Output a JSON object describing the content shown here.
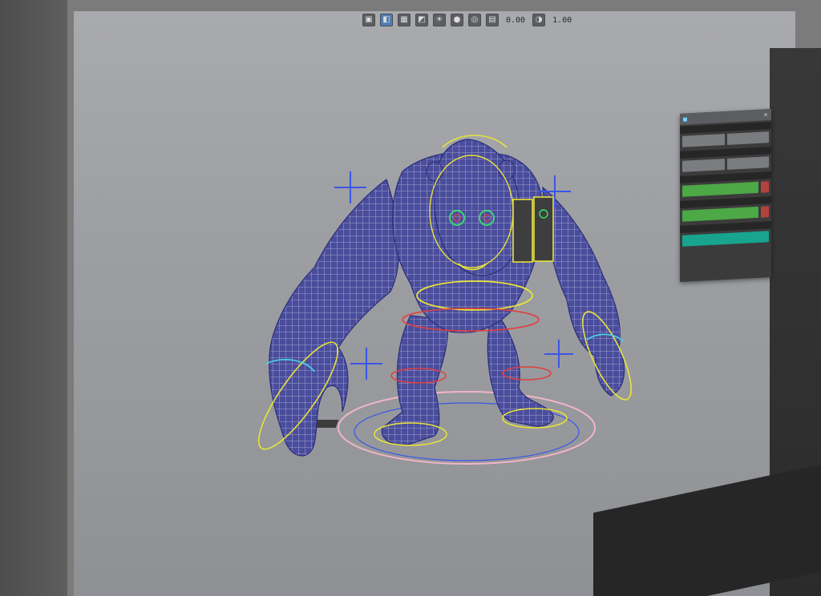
{
  "toolbar": {
    "icons": [
      "cube-icon",
      "shaded-icon",
      "wireframe-icon",
      "texture-icon",
      "light-icon",
      "sphere-icon",
      "camera-icon",
      "grid-icon"
    ],
    "exposure_value": "0.00",
    "gamma_value": "1.00"
  },
  "panel": {
    "close_label": "×"
  },
  "colors": {
    "mesh": "#3c3f8e",
    "wire": "#c9cbe6",
    "ctrl_yellow": "#e8e23a",
    "ctrl_blue": "#3a55e8",
    "ctrl_green": "#38e36a",
    "ctrl_red": "#e04040",
    "ctrl_cyan": "#4ad7e8",
    "ctrl_pink": "#f1b6c4",
    "ui_green": "#4da846",
    "ui_teal": "#18a48f"
  }
}
